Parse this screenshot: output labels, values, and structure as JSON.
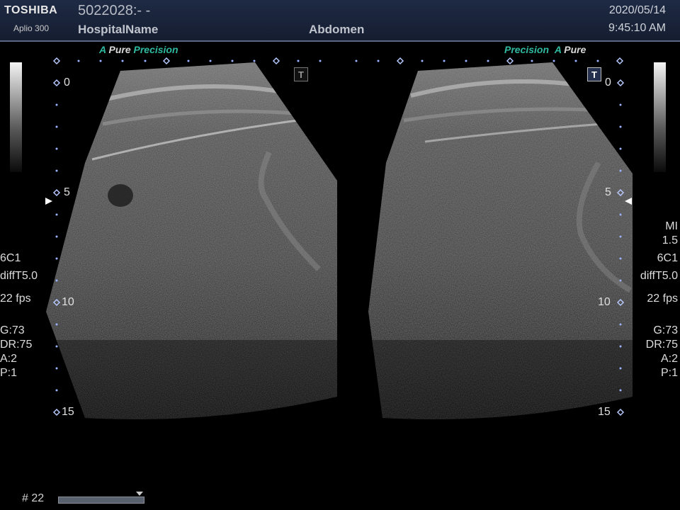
{
  "header": {
    "brand": "TOSHIBA",
    "model": "Aplio 300",
    "patient_id": "5022028:- -",
    "hospital": "HospitalName",
    "preset": "Abdomen",
    "date": "2020/05/14",
    "time": "9:45:10 AM"
  },
  "left_image": {
    "tag": {
      "a": "A",
      "pure": "Pure",
      "precision": "Precision"
    },
    "depth_labels": [
      "0",
      "5",
      "10",
      "15"
    ],
    "params": {
      "probe": "6C1",
      "mode": "diffT5.0",
      "fps": "22 fps",
      "gain": "G:73",
      "dr": "DR:75",
      "a": "A:2",
      "p": "P:1"
    }
  },
  "right_image": {
    "tag": {
      "precision": "Precision",
      "a": "A",
      "pure": "Pure"
    },
    "depth_labels": [
      "0",
      "5",
      "10",
      "15"
    ],
    "params": {
      "mi_label": "MI",
      "mi_value": "1.5",
      "probe": "6C1",
      "mode": "diffT5.0",
      "fps": "22 fps",
      "gain": "G:73",
      "dr": "DR:75",
      "a": "A:2",
      "p": "P:1"
    }
  },
  "t_button_label": "T",
  "cine": {
    "frame": "# 22",
    "position_fraction": 0.94
  },
  "colors": {
    "header_bg": "#1e2a44",
    "accent": "#2fb9a0",
    "marker": "#9ab4ff"
  }
}
